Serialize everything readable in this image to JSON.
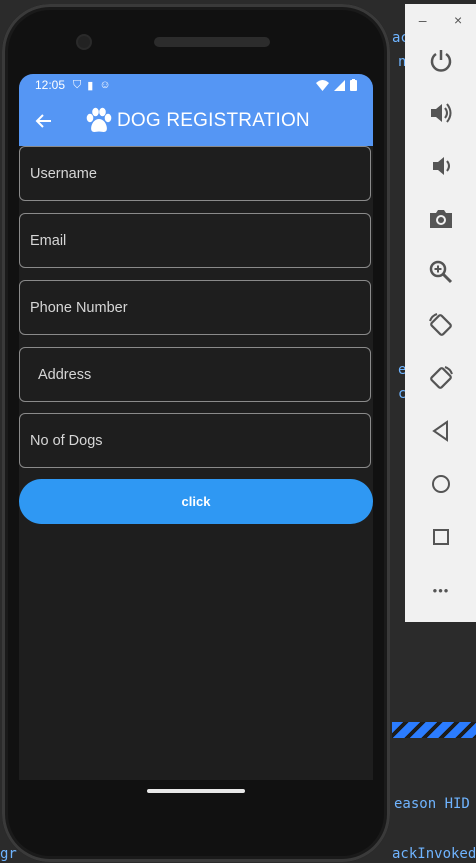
{
  "status_bar": {
    "time": "12:05"
  },
  "app_bar": {
    "title": "DOG REGISTRATION"
  },
  "form": {
    "fields": [
      {
        "label": "Username"
      },
      {
        "label": "Email"
      },
      {
        "label": "Phone Number"
      },
      {
        "label": "Address"
      },
      {
        "label": "No of Dogs"
      }
    ],
    "submit_label": "click"
  },
  "ide_fragments": {
    "top1": "ac",
    "top2": "n",
    "mid1": "e",
    "mid2": "c",
    "reason": "eason HID",
    "bottom": "ackInvokedCa",
    "bottom_left": "gr"
  },
  "emulator_toolbar": {
    "minimize": "–",
    "close": "×",
    "more": "•••"
  },
  "colors": {
    "app_bar": "#5596f4",
    "button": "#2f98f3",
    "screen_bg": "#1e1e1e"
  }
}
